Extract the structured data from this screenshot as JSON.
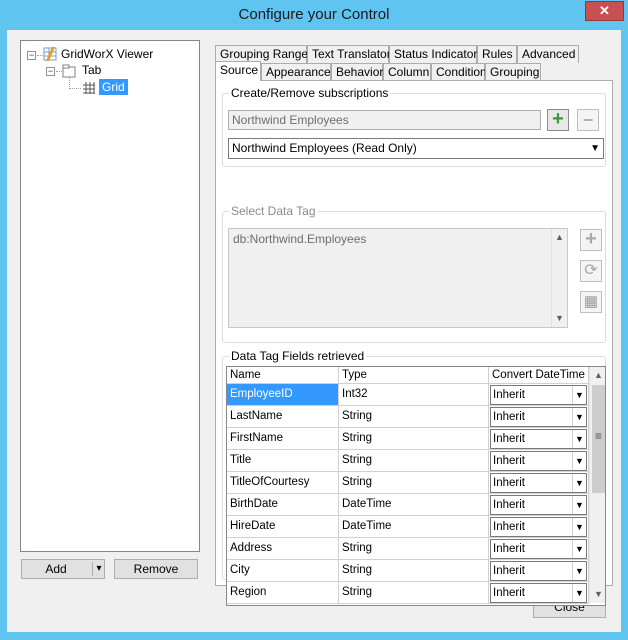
{
  "window": {
    "title": "Configure your Control",
    "close_glyph": "✕"
  },
  "tree": {
    "root": {
      "label": "GridWorX Viewer",
      "expander": "−"
    },
    "child": {
      "label": "Tab",
      "expander": "−"
    },
    "leaf": {
      "label": "Grid"
    }
  },
  "left_buttons": {
    "add": "Add",
    "add_dropdown": "▾",
    "remove": "Remove"
  },
  "tabs": {
    "row1": [
      "Grouping Range",
      "Text Translator",
      "Status Indicator",
      "Rules",
      "Advanced"
    ],
    "row2": [
      "Source",
      "Appearance",
      "Behavior",
      "Column",
      "Condition",
      "Grouping"
    ],
    "active": "Source"
  },
  "subscriptions": {
    "title": "Create/Remove subscriptions",
    "input_value": "Northwind Employees",
    "add_glyph": "+",
    "remove_glyph": "−",
    "selected": "Northwind Employees (Read Only)",
    "dropdown_arrow": "▼"
  },
  "data_tag": {
    "title": "Select Data Tag",
    "value": "db:Northwind.Employees",
    "scroll_up": "▲",
    "scroll_down": "▼",
    "add_glyph": "+",
    "refresh_glyph": "⟳",
    "table_glyph": "▦"
  },
  "fields": {
    "title": "Data Tag Fields retrieved",
    "columns": [
      "Name",
      "Type",
      "Convert DateTime"
    ],
    "rows": [
      {
        "name": "EmployeeID",
        "type": "Int32",
        "convert": "Inherit"
      },
      {
        "name": "LastName",
        "type": "String",
        "convert": "Inherit"
      },
      {
        "name": "FirstName",
        "type": "String",
        "convert": "Inherit"
      },
      {
        "name": "Title",
        "type": "String",
        "convert": "Inherit"
      },
      {
        "name": "TitleOfCourtesy",
        "type": "String",
        "convert": "Inherit"
      },
      {
        "name": "BirthDate",
        "type": "DateTime",
        "convert": "Inherit"
      },
      {
        "name": "HireDate",
        "type": "DateTime",
        "convert": "Inherit"
      },
      {
        "name": "Address",
        "type": "String",
        "convert": "Inherit"
      },
      {
        "name": "City",
        "type": "String",
        "convert": "Inherit"
      },
      {
        "name": "Region",
        "type": "String",
        "convert": "Inherit"
      }
    ],
    "dropdown_arrow": "▼",
    "scroll_up": "▲",
    "scroll_down": "▼",
    "thumb_grip": "≡"
  },
  "footer": {
    "close": "Close"
  },
  "colors": {
    "titlebar": "#5fc4f0",
    "selection": "#3399ff",
    "close_button": "#c75050",
    "add_icon_green": "#3a9a3a"
  }
}
